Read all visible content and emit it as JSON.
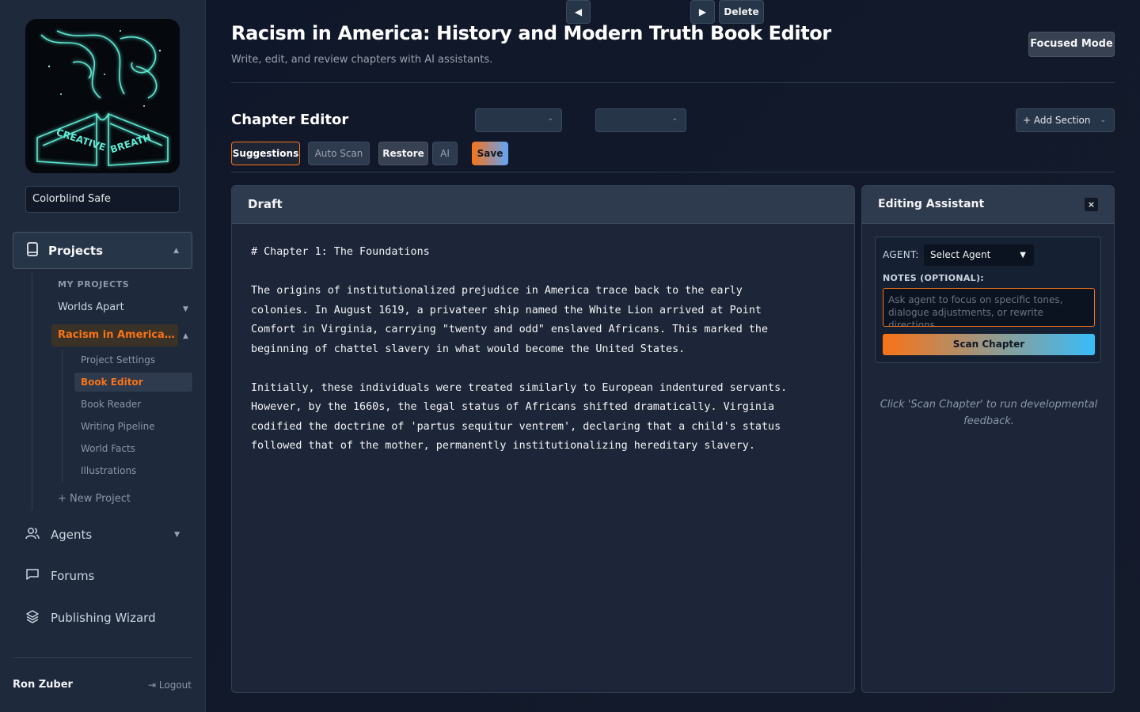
{
  "sidebar": {
    "logo_text": [
      "CREATIVE",
      "BREATH"
    ],
    "theme_select": "Colorblind Safe",
    "projects_label": "Projects",
    "my_projects_heading": "MY PROJECTS",
    "projects": [
      {
        "label": "Worlds Apart"
      },
      {
        "label": "Racism in America: History and Modern Truth"
      }
    ],
    "sub_items": [
      "Project Settings",
      "Book Editor",
      "Book Reader",
      "Writing Pipeline",
      "World Facts",
      "Illustrations"
    ],
    "new_project": "+ New Project",
    "agents_label": "Agents",
    "forums_label": "Forums",
    "publishing_label": "Publishing Wizard",
    "username": "Ron Zuber",
    "logout": "Logout"
  },
  "header": {
    "title": "Racism in America: History and Modern Truth Book Editor",
    "subtitle": "Write, edit, and review chapters with AI assistants.",
    "focused_mode": "Focused Mode"
  },
  "toolbar": {
    "section_title": "Chapter Editor",
    "prev": "◀",
    "next": "▶",
    "delete": "Delete",
    "add_section": "+ Add Section",
    "suggestions": "Suggestions",
    "auto_scan": "Auto Scan",
    "restore": "Restore",
    "ai": "AI",
    "save": "Save"
  },
  "draft": {
    "title": "Draft",
    "content": "# Chapter 1: The Foundations\n\nThe origins of institutionalized prejudice in America trace back to the early\ncolonies. In August 1619, a privateer ship named the White Lion arrived at Point\nComfort in Virginia, carrying \"twenty and odd\" enslaved Africans. This marked the\nbeginning of chattel slavery in what would become the United States.\n\nInitially, these individuals were treated similarly to European indentured servants.\nHowever, by the 1660s, the legal status of Africans shifted dramatically. Virginia\ncodified the doctrine of 'partus sequitur ventrem', declaring that a child's status\nfollowed that of the mother, permanently institutionalizing hereditary slavery."
  },
  "assistant": {
    "title": "Editing Assistant",
    "close": "×",
    "agent_label": "AGENT:",
    "agent_select": "Select Agent",
    "notes_label": "NOTES (OPTIONAL):",
    "notes_placeholder": "Ask agent to focus on specific tones, dialogue adjustments, or rewrite directions...",
    "scan_button": "Scan Chapter",
    "hint": "Click 'Scan Chapter' to run developmental feedback."
  },
  "colors": {
    "accent": "#f97316",
    "accent_secondary": "#38bdf8",
    "background": "#111827"
  }
}
